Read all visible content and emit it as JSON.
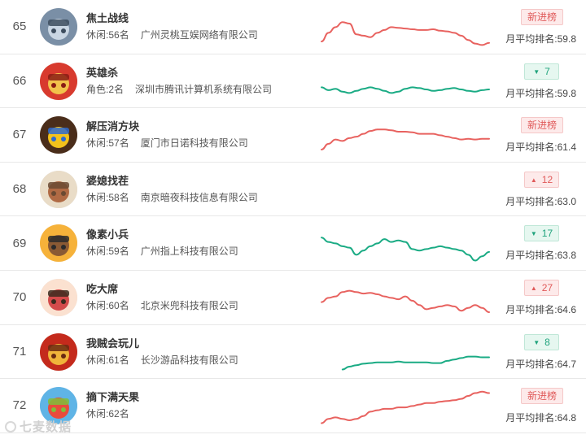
{
  "colors": {
    "up_line": "#e8625f",
    "down_line": "#1aab84",
    "new_line": "#e8625f"
  },
  "watermark": "七麦数据",
  "rows": [
    {
      "rank": "65",
      "name": "焦土战线",
      "category": "休闲:56名",
      "company": "广州灵桃互娱网络有限公司",
      "badge_type": "new",
      "badge_arrow": "",
      "badge_value": "新进榜",
      "avg": "月平均排名:59.8",
      "icon": "airship-game-icon",
      "trend": "up",
      "spark": [
        8,
        20,
        28,
        35,
        33,
        18,
        16,
        14,
        20,
        24,
        28,
        27,
        26,
        25,
        24,
        24,
        25,
        23,
        22,
        20,
        16,
        10,
        5,
        3,
        6
      ]
    },
    {
      "rank": "66",
      "name": "英雄杀",
      "category": "角色:2名",
      "company": "深圳市腾讯计算机系统有限公司",
      "badge_type": "down",
      "badge_arrow": "▼",
      "badge_value": "7",
      "avg": "月平均排名:59.8",
      "icon": "hero-kill-game-icon",
      "trend": "down",
      "spark": [
        20,
        16,
        18,
        14,
        12,
        15,
        18,
        20,
        18,
        15,
        12,
        14,
        18,
        20,
        19,
        17,
        15,
        16,
        18,
        19,
        17,
        15,
        14,
        16,
        17
      ]
    },
    {
      "rank": "67",
      "name": "解压消方块",
      "category": "休闲:57名",
      "company": "厦门市日诺科技有限公司",
      "badge_type": "new",
      "badge_arrow": "",
      "badge_value": "新进榜",
      "avg": "月平均排名:61.4",
      "icon": "block-puzzle-icon",
      "trend": "up",
      "spark": [
        8,
        16,
        22,
        20,
        24,
        26,
        30,
        34,
        36,
        36,
        35,
        33,
        33,
        32,
        30,
        30,
        30,
        28,
        26,
        24,
        22,
        23,
        22,
        23,
        23
      ]
    },
    {
      "rank": "68",
      "name": "婆媳找茬",
      "category": "休闲:58名",
      "company": "南京暗夜科技信息有限公司",
      "badge_type": "up",
      "badge_arrow": "▲",
      "badge_value": "12",
      "avg": "月平均排名:63.0",
      "icon": "mother-in-law-game-icon",
      "trend": "none",
      "spark": []
    },
    {
      "rank": "69",
      "name": "像素小兵",
      "category": "休闲:59名",
      "company": "广州指上科技有限公司",
      "badge_type": "down",
      "badge_arrow": "▼",
      "badge_value": "17",
      "avg": "月平均排名:63.8",
      "icon": "pixel-soldier-icon",
      "trend": "down",
      "spark": [
        36,
        30,
        28,
        24,
        22,
        12,
        18,
        24,
        28,
        34,
        30,
        32,
        30,
        20,
        18,
        20,
        22,
        24,
        22,
        20,
        18,
        12,
        4,
        10,
        16
      ]
    },
    {
      "rank": "70",
      "name": "吃大席",
      "category": "休闲:60名",
      "company": "北京米兜科技有限公司",
      "badge_type": "up",
      "badge_arrow": "▲",
      "badge_value": "27",
      "avg": "月平均排名:64.6",
      "icon": "banquet-game-icon",
      "trend": "up",
      "spark": [
        22,
        28,
        30,
        36,
        38,
        36,
        34,
        35,
        33,
        30,
        28,
        26,
        30,
        24,
        18,
        12,
        14,
        16,
        18,
        16,
        10,
        14,
        18,
        14,
        8
      ]
    },
    {
      "rank": "71",
      "name": "我贼会玩儿",
      "category": "休闲:61名",
      "company": "长沙游品科技有限公司",
      "badge_type": "down",
      "badge_arrow": "▼",
      "badge_value": "8",
      "avg": "月平均排名:64.7",
      "icon": "treasure-game-icon",
      "trend": "down",
      "spark": [
        null,
        null,
        null,
        4,
        8,
        10,
        12,
        13,
        14,
        14,
        14,
        15,
        14,
        14,
        14,
        14,
        13,
        13,
        16,
        18,
        20,
        22,
        22,
        21,
        21
      ]
    },
    {
      "rank": "72",
      "name": "摘下满天果",
      "category": "休闲:62名",
      "company": "",
      "badge_type": "new",
      "badge_arrow": "",
      "badge_value": "新进榜",
      "avg": "月平均排名:64.8",
      "icon": "fruit-basket-icon",
      "trend": "up",
      "spark": [
        4,
        10,
        12,
        10,
        8,
        10,
        14,
        20,
        22,
        24,
        24,
        26,
        26,
        28,
        30,
        32,
        32,
        34,
        35,
        36,
        38,
        42,
        46,
        48,
        46
      ]
    }
  ]
}
